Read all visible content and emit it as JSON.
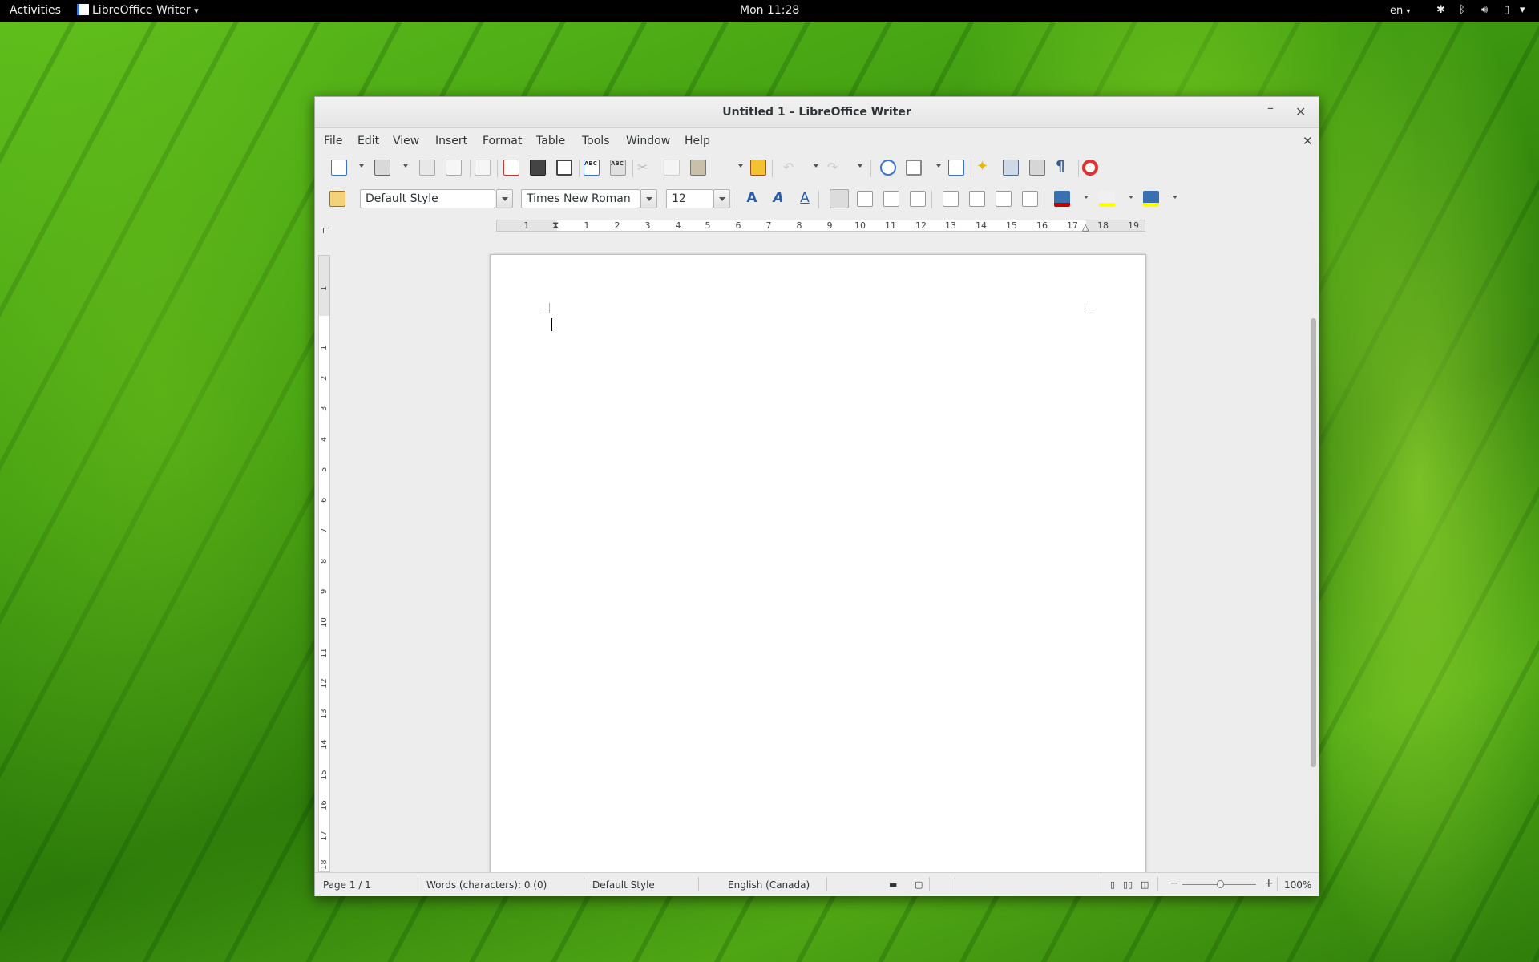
{
  "topbar": {
    "activities": "Activities",
    "app_name": "LibreOffice Writer",
    "app_caret": "▾",
    "clock": "Mon 11:28",
    "language": "en",
    "language_caret": "▾"
  },
  "window": {
    "title": "Untitled 1 – LibreOffice Writer",
    "minimize": "–",
    "close": "✕"
  },
  "menu": {
    "file": "File",
    "edit": "Edit",
    "view": "View",
    "insert": "Insert",
    "format": "Format",
    "table": "Table",
    "tools": "Tools",
    "window": "Window",
    "help": "Help",
    "close_doc": "✕"
  },
  "formatting": {
    "paragraph_style": "Default Style",
    "font_name": "Times New Roman",
    "font_size": "12"
  },
  "ruler": {
    "h_numbers": [
      "1",
      "1",
      "2",
      "3",
      "4",
      "5",
      "6",
      "7",
      "8",
      "9",
      "10",
      "11",
      "12",
      "13",
      "14",
      "15",
      "16",
      "17",
      "18",
      "19"
    ],
    "v_numbers": [
      "1",
      "1",
      "2",
      "3",
      "4",
      "5",
      "6",
      "7",
      "8",
      "9",
      "10",
      "11",
      "12",
      "13",
      "14",
      "15",
      "16",
      "17",
      "18"
    ]
  },
  "status": {
    "page": "Page 1 / 1",
    "words": "Words (characters): 0 (0)",
    "page_style": "Default Style",
    "language": "English (Canada)",
    "zoom_minus": "−",
    "zoom_plus": "+",
    "zoom": "100%"
  },
  "colors": {
    "accent_blue": "#3874d8",
    "desktop_green": "#3e9a10",
    "font_color_red": "#c00000",
    "highlight_yellow": "#ffff00"
  }
}
